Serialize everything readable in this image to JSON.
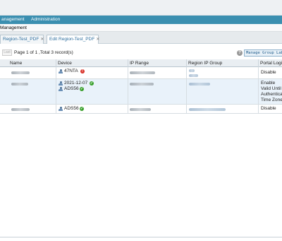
{
  "menu": {
    "items": [
      "anagement",
      "Administration"
    ]
  },
  "breadcrumb": "Management",
  "tabs": [
    {
      "label": "Region-Test_PDF"
    },
    {
      "label": "Edit Region-Test_PDF"
    }
  ],
  "tab_close_glyph": "✕",
  "toolbar": {
    "prev_label": "Last",
    "pager_text": "Page 1 of 1 ,Total 3 record(s)",
    "help_glyph": "?",
    "manage_label": "Manage Group Lab"
  },
  "grid": {
    "columns": [
      "Name",
      "Device",
      "IP Range",
      "Region IP Group",
      "Portal Logi"
    ],
    "rows": [
      {
        "devices": [
          {
            "label": "47NTA",
            "status": "err",
            "glyph": "!"
          }
        ],
        "portal": [
          "Disable"
        ]
      },
      {
        "devices": [
          {
            "label": "2021-12-07",
            "status": "ok",
            "glyph": "✓"
          },
          {
            "label": "ADS56",
            "status": "ok",
            "glyph": "✓"
          }
        ],
        "portal": [
          "Enable",
          "Valid Until",
          "Authenticat",
          "Time Zone:"
        ]
      },
      {
        "devices": [
          {
            "label": "ADS56",
            "status": "ok",
            "glyph": "✓"
          }
        ],
        "portal": [
          "Disable"
        ]
      }
    ]
  },
  "colors": {
    "menubar": "#3b8fb0",
    "row_alt": "#e9f2fa",
    "ok": "#3aa02c",
    "error": "#d8332b"
  }
}
